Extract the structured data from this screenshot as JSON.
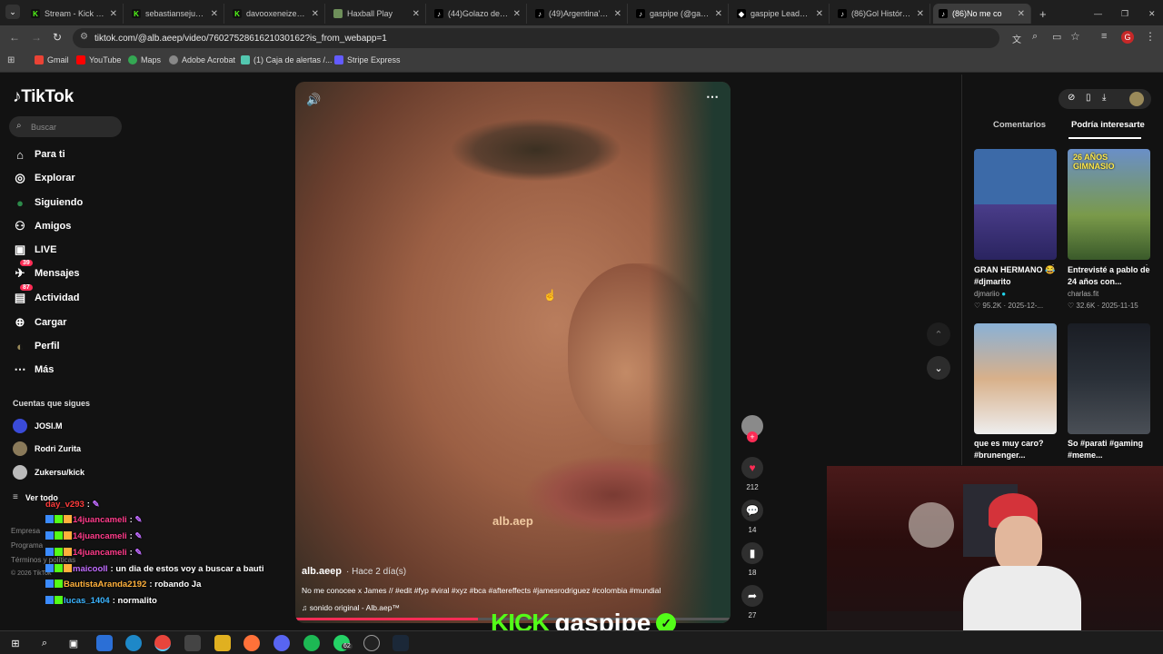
{
  "browser": {
    "tabs": [
      {
        "label": "Stream - Kick Dash",
        "icon": "kick-icon",
        "color": "#53fc18"
      },
      {
        "label": "sebastiansejuro St",
        "icon": "kick-icon",
        "color": "#53fc18"
      },
      {
        "label": "davooxeneize Stre",
        "icon": "kick-icon",
        "color": "#53fc18"
      },
      {
        "label": "Haxball Play",
        "icon": "haxball-icon",
        "color": "#6e8f5a"
      },
      {
        "label": "(44)Golazo de Riv",
        "icon": "tiktok-icon",
        "color": "#ffffff"
      },
      {
        "label": "(49)Argentina's Le",
        "icon": "tiktok-icon",
        "color": "#ffffff"
      },
      {
        "label": "gaspipe (@gaspip",
        "icon": "tiktok-icon",
        "color": "#ffffff"
      },
      {
        "label": "gaspipe LeaderBo",
        "icon": "leaderboard-icon",
        "color": "#ffffff"
      },
      {
        "label": "(86)Gol Histórico",
        "icon": "tiktok-icon",
        "color": "#ffffff"
      },
      {
        "label": "(86)No me co",
        "icon": "tiktok-icon",
        "color": "#ffffff",
        "active": true
      }
    ],
    "url": "tiktok.com/@alb.aeep/video/7602752861621030162?is_from_webapp=1",
    "bookmarks": [
      "Gmail",
      "YouTube",
      "Maps",
      "Adobe Acrobat",
      "(1) Caja de alertas /...",
      "Stripe Express"
    ],
    "profile_initial": "G"
  },
  "tiktok": {
    "logo": "TikTok",
    "search_placeholder": "Buscar",
    "nav": [
      {
        "label": "Para ti",
        "icon": "home-icon"
      },
      {
        "label": "Explorar",
        "icon": "compass-icon"
      },
      {
        "label": "Siguiendo",
        "icon": "following-icon"
      },
      {
        "label": "Amigos",
        "icon": "friends-icon"
      },
      {
        "label": "LIVE",
        "icon": "live-icon"
      },
      {
        "label": "Mensajes",
        "icon": "messages-icon",
        "badge": "39"
      },
      {
        "label": "Actividad",
        "icon": "activity-icon",
        "badge": "87"
      },
      {
        "label": "Cargar",
        "icon": "upload-icon"
      },
      {
        "label": "Perfil",
        "icon": "profile-icon"
      },
      {
        "label": "Más",
        "icon": "more-icon"
      }
    ],
    "following_header": "Cuentas que sigues",
    "following": [
      "JOSI.M",
      "Rodri Zurita",
      "Zukersu/kick"
    ],
    "see_all": "Ver todo",
    "footer": [
      "Empresa",
      "Programa",
      "Términos y políticas",
      "© 2026 TikTok"
    ],
    "video": {
      "watermark": "alb.aep",
      "username": "alb.aeep",
      "time": "· Hace 2 día(s)",
      "caption": "No me conocee x James // #edit #fyp #viral #xyz #bca #aftereffects #jamesrodriguez #colombia #mundial",
      "sound": "sonido original - Alb.aep™",
      "likes": "212",
      "comments": "14",
      "saves": "18",
      "shares": "27"
    },
    "right_panel": {
      "tabs": [
        "Comentarios",
        "Podría interesarte"
      ],
      "cards": [
        {
          "title": "GRAN HERMANO 😂 #djmarito",
          "author": "djmariio",
          "likes": "95.2K",
          "date": "2025-12-...",
          "thumb_color": "#3c6aa8",
          "overlay": ""
        },
        {
          "title": "Entrevisté a pablo de 24 años con...",
          "author": "charlas.fit",
          "likes": "32.6K",
          "date": "2025-11-15",
          "thumb_color": "#6a8f3a",
          "overlay": "26 AÑOS GIMNASIO"
        },
        {
          "title": "que es muy caro? #brunenger...",
          "author": "",
          "likes": "",
          "date": "",
          "thumb_color": "#8ab1d6",
          "overlay": ""
        },
        {
          "title": "So #parati #gaming #meme...",
          "author": "",
          "likes": "",
          "date": "",
          "thumb_color": "#1a1d24",
          "overlay": ""
        }
      ]
    }
  },
  "chat": [
    {
      "user": "day_v293",
      "text": ":",
      "color": "#ff3b3b"
    },
    {
      "user": "14juancameli",
      "text": ":",
      "color": "#ff3b8a"
    },
    {
      "user": "14juancameli",
      "text": ":",
      "color": "#ff3b8a"
    },
    {
      "user": "14juancameli",
      "text": ":",
      "color": "#ff3b8a"
    },
    {
      "user": "maicoolI",
      "text": ": un dia de estos voy a buscar a bauti",
      "color": "#c06bff"
    },
    {
      "user": "BautistaAranda2192",
      "text": ": robando Ja",
      "color": "#ffb03b"
    },
    {
      "user": "lucas_1404",
      "text": ": normalito",
      "color": "#3bb4ff"
    }
  ],
  "stream_brand": {
    "platform": "KICK",
    "channel": "gaspipe",
    "color": "#53fc18"
  },
  "taskbar": {
    "whatsapp_badge": "62"
  }
}
